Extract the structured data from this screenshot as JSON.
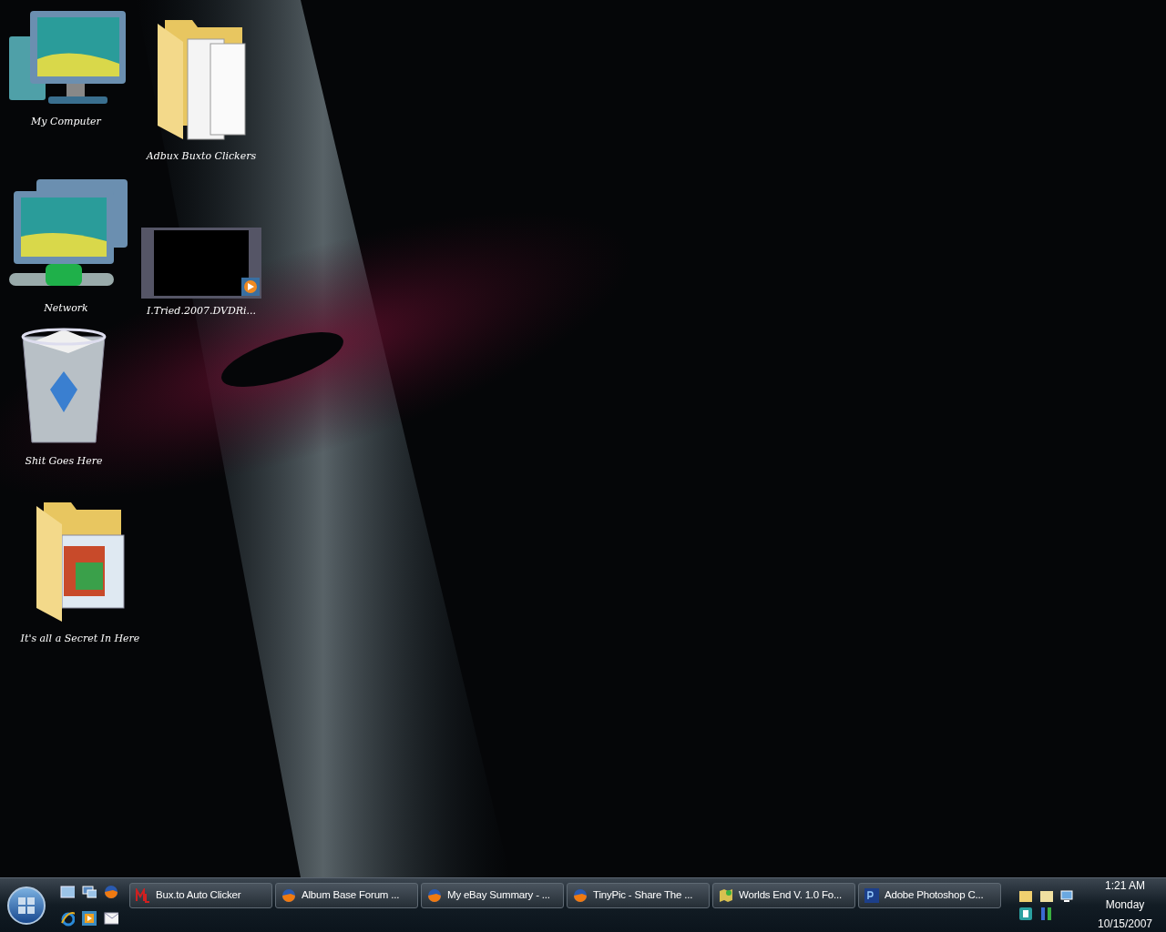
{
  "desktop_icons": [
    {
      "label": "My Computer",
      "kind": "computer"
    },
    {
      "label": "Adbux Buxto Clickers",
      "kind": "folder"
    },
    {
      "label": "Network",
      "kind": "network"
    },
    {
      "label": "I.Tried.2007.DVDRi...",
      "kind": "video"
    },
    {
      "label": "Shit Goes Here",
      "kind": "recycle-bin"
    },
    {
      "label": "It's all a Secret In Here",
      "kind": "folder-pictures"
    }
  ],
  "taskbar": {
    "quick_launch": [
      {
        "kind": "desktop"
      },
      {
        "kind": "windows"
      },
      {
        "kind": "browser-fox"
      },
      {
        "kind": "browser-e"
      },
      {
        "kind": "media"
      },
      {
        "kind": "mail"
      }
    ],
    "tasks": [
      {
        "label": "Bux.to Auto Clicker",
        "kind": "ml"
      },
      {
        "label": "Album Base Forum ...",
        "kind": "fox"
      },
      {
        "label": "My eBay Summary - ...",
        "kind": "fox"
      },
      {
        "label": "TinyPic - Share The ...",
        "kind": "fox"
      },
      {
        "label": "Worlds End V. 1.0 Fo...",
        "kind": "map"
      },
      {
        "label": "Adobe Photoshop C...",
        "kind": "ps"
      }
    ],
    "tray": {
      "time": "1:21 AM",
      "day": "Monday",
      "date": "10/15/2007"
    }
  }
}
